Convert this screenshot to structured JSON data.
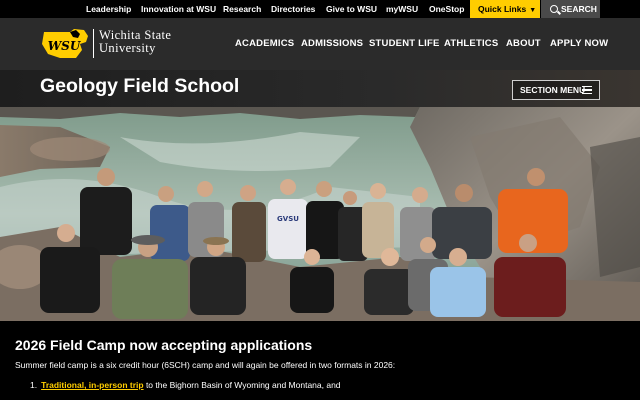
{
  "utility": {
    "links": [
      "Leadership",
      "Innovation at WSU",
      "Research",
      "Directories",
      "Give to WSU",
      "myWSU",
      "OneStop"
    ],
    "quick_links": "Quick Links",
    "search": "SEARCH"
  },
  "header": {
    "logo_text": "WSU",
    "wordmark_line1": "Wichita State",
    "wordmark_line2": "University",
    "nav": [
      "ACADEMICS",
      "ADMISSIONS",
      "STUDENT LIFE",
      "ATHLETICS",
      "ABOUT",
      "APPLY NOW"
    ]
  },
  "page": {
    "title": "Geology Field School",
    "section_menu": "SECTION MENU"
  },
  "hero_shirt_text": "GVSU",
  "content": {
    "heading": "2026 Field Camp now accepting applications",
    "paragraph": "Summer field camp is a six credit hour (6SCH) camp and will again be offered in two formats in 2026:",
    "list": [
      {
        "number": "1.",
        "link": "Traditional, in-person trip",
        "text": " to the Bighorn Basin of Wyoming and Montana, and"
      }
    ]
  },
  "colors": {
    "brand_gold": "#ffcd00",
    "header_bg": "#2b2b2b",
    "utility_bg": "#000000"
  }
}
